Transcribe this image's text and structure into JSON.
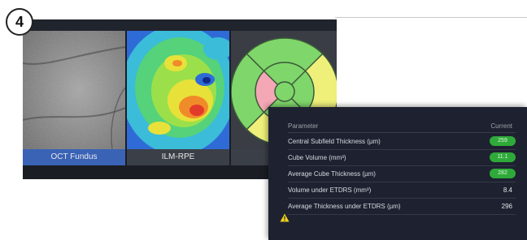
{
  "step_number": "4",
  "viewer": {
    "panels": [
      {
        "label": "OCT Fundus",
        "label_bg": "#3a63b6"
      },
      {
        "label": "ILM-RPE",
        "label_bg": "#3b3f47"
      },
      {
        "label": "",
        "label_bg": "#3b3f47"
      }
    ]
  },
  "parameters": {
    "header": {
      "parameter": "Parameter",
      "current": "Current"
    },
    "rows": [
      {
        "name": "Central Subfield Thickness (µm)",
        "value": "259",
        "style": "pill"
      },
      {
        "name": "Cube Volume (mm³)",
        "value": "11.1",
        "style": "pill"
      },
      {
        "name": "Average Cube Thickness (µm)",
        "value": "282",
        "style": "pill"
      },
      {
        "name": "Volume under ETDRS (mm³)",
        "value": "8.4",
        "style": "plain"
      },
      {
        "name": "Average Thickness under ETDRS (µm)",
        "value": "296",
        "style": "plain"
      }
    ]
  },
  "colors": {
    "normal_green": "#2faa3a",
    "warning_yellow": "#f2d21b",
    "sector_pink": "#f4a7b4",
    "sector_yellow": "#eef07a",
    "sector_green": "#7fd66a"
  },
  "icons": [
    "warning-icon"
  ]
}
